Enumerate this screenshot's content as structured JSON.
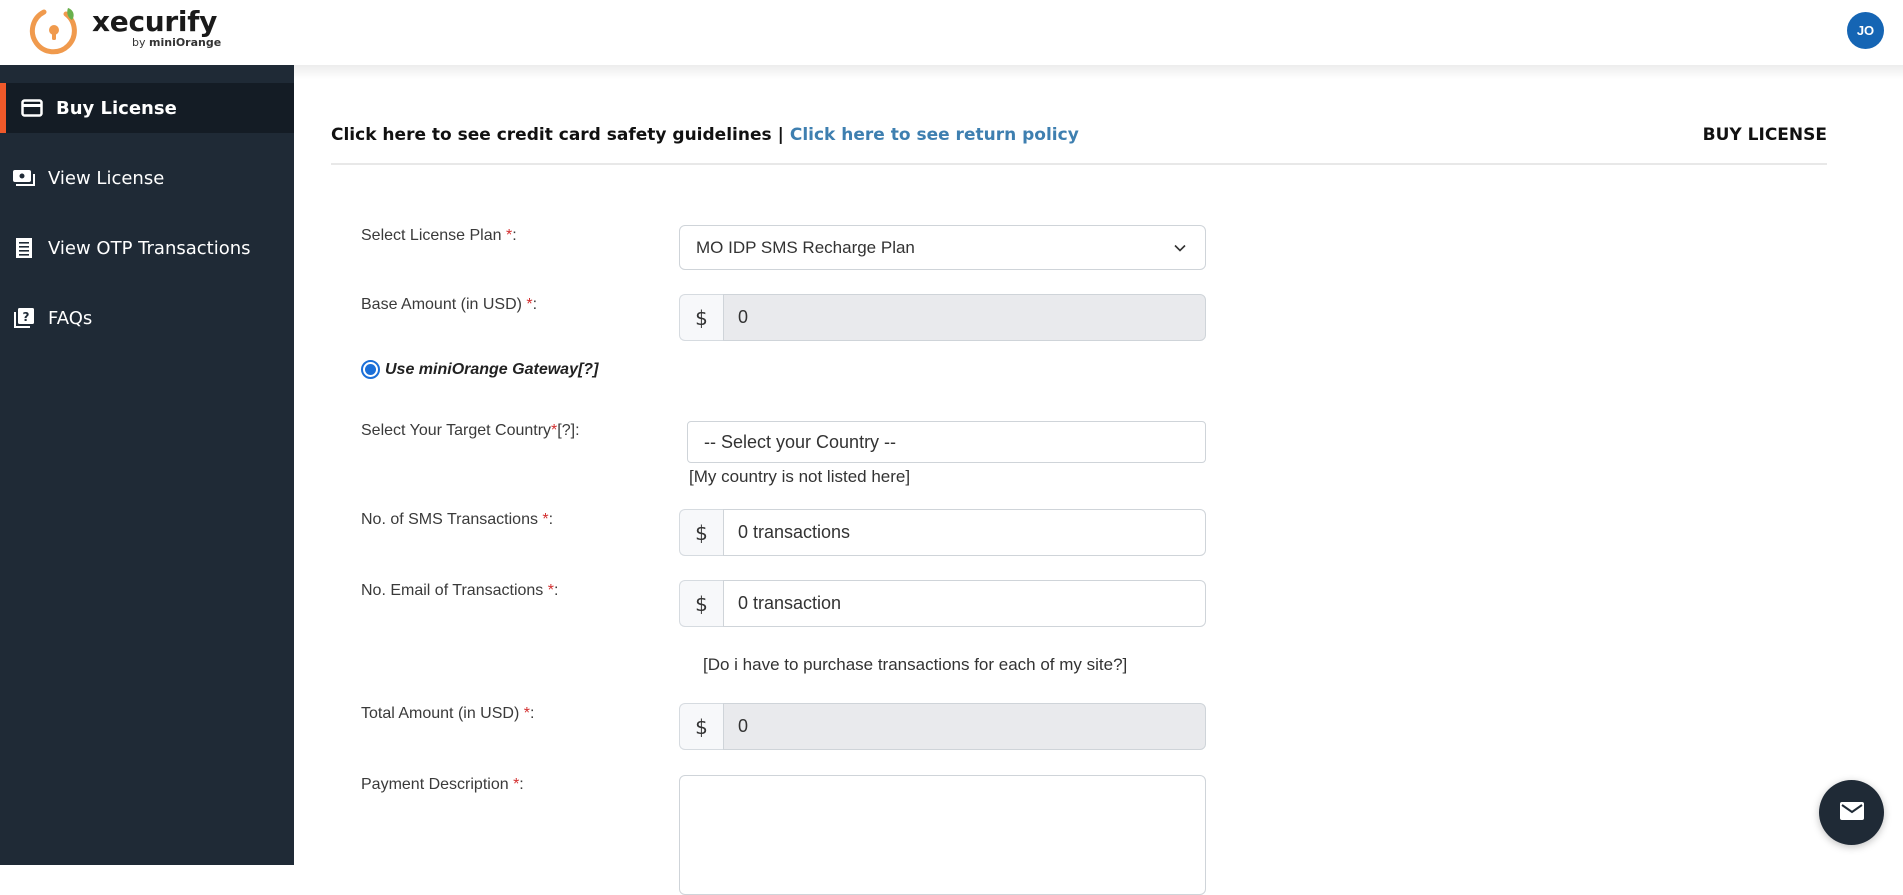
{
  "app": {
    "logo_name": "xecurify",
    "logo_by": "by",
    "logo_brand": "miniOrange",
    "avatar_initials": "JO"
  },
  "sidebar": {
    "items": [
      {
        "label": "Buy License",
        "icon": "credit-card-icon",
        "active": true
      },
      {
        "label": "View License",
        "icon": "license-icon",
        "active": false
      },
      {
        "label": "View OTP Transactions",
        "icon": "receipt-icon",
        "active": false
      },
      {
        "label": "FAQs",
        "icon": "faq-icon",
        "active": false
      }
    ]
  },
  "header": {
    "safety_text": "Click here to see credit card safety guidelines",
    "separator": "|",
    "return_policy_link": "Click here to see return policy",
    "page_title": "BUY LICENSE"
  },
  "form": {
    "license_plan": {
      "label": "Select License Plan ",
      "required": "*",
      "suffix": ":",
      "value": "MO IDP SMS Recharge Plan"
    },
    "base_amount": {
      "label": "Base Amount (in USD) ",
      "required": "*",
      "suffix": ":",
      "addon": "$",
      "value": "0"
    },
    "gateway": {
      "label": "Use miniOrange Gateway[?]",
      "checked": true
    },
    "country": {
      "label": "Select Your Target Country",
      "required": "*",
      "suffix": "[?]:",
      "value": "-- Select your Country --",
      "note": "[My country is not listed here]"
    },
    "sms": {
      "label": "No. of SMS Transactions ",
      "required": "*",
      "suffix": ":",
      "addon": "$",
      "value": "0 transactions"
    },
    "email": {
      "label": "No. Email of Transactions ",
      "required": "*",
      "suffix": ":",
      "addon": "$",
      "value": "0 transaction"
    },
    "site_note": "[Do i have to purchase transactions for each of my site?]",
    "total_amount": {
      "label": "Total Amount (in USD) ",
      "required": "*",
      "suffix": ":",
      "addon": "$",
      "value": "0"
    },
    "payment_description": {
      "label": "Payment Description ",
      "required": "*",
      "suffix": ":",
      "value": ""
    }
  },
  "colors": {
    "sidebar_bg": "#1f2a36",
    "active_accent": "#f0592a",
    "link": "#3e7fb0",
    "avatar": "#1565b4"
  }
}
